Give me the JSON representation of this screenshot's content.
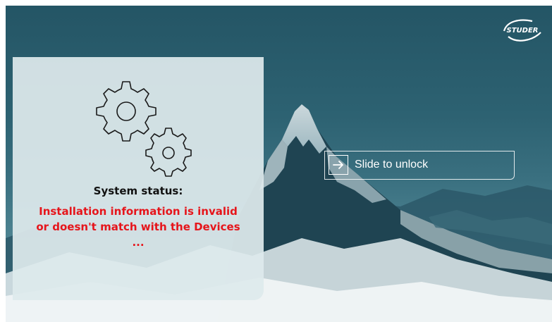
{
  "brand": {
    "logo_text": "STUDER"
  },
  "status": {
    "title": "System status:",
    "message_lines": [
      "Installation information is invalid",
      "or doesn't match with the Devices",
      "..."
    ],
    "message_color": "#e6151b"
  },
  "unlock": {
    "label": "Slide to unlock",
    "handle_icon": "arrow-right-icon"
  },
  "icons": {
    "status": "gears-icon",
    "logo": "studer-logo"
  }
}
